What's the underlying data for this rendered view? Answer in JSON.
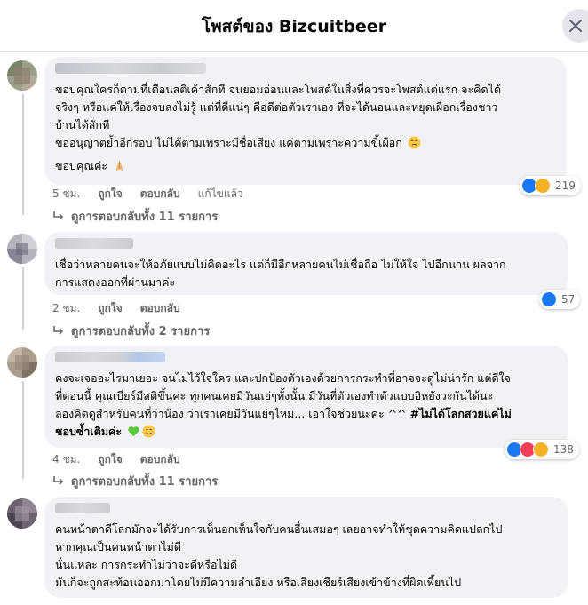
{
  "header": {
    "title": "โพสต์ของ Bizcuitbeer"
  },
  "comments": [
    {
      "lines": [
        "ขอบคุณใครก็ตามที่เตือนสติเค้าสักที จนยอมอ่อนและโพสต์ในสิ่งที่ควรจะโพสต์แต่แรก จะคิดได้",
        "จริงๆ หรือแค่ให้เรื่องจบลงไม่รู้ แต่ที่ดีแน่ๆ คือดีต่อตัวเราเอง ที่จะได้นอนและหยุดเผือกเรื่องชาว",
        "บ้านได้สักที",
        "ขออนุญาตย้ำอีกรอบ ไม่ได้ตามเพราะมีชื่อเสียง แค่ตามเพราะความขี้เผือก",
        "ขอบคุณค่ะ"
      ],
      "time": "5 ชม.",
      "like": "ถูกใจ",
      "reply": "ตอบกลับ",
      "edited": "แก้ไขแล้ว",
      "reaction_count": "219",
      "replies_label": "ดูการตอบกลับทั้ง 11 รายการ"
    },
    {
      "lines": [
        "เชื่อว่าหลายคนจะให้อภัยแบบไม่คิดอะไร แต่ก็มีอีกหลายคนไม่เชื่อถือ ไม่ให้ใจ ไปอีกนาน ผลจาก",
        "การแสดงออกที่ผ่านมาค่ะ"
      ],
      "time": "2 ชม.",
      "like": "ถูกใจ",
      "reply": "ตอบกลับ",
      "reaction_count": "57",
      "replies_label": "ดูการตอบกลับทั้ง 2 รายการ"
    },
    {
      "lines": [
        "คงจะเจออะไรมาเยอะ จนไม่ไว้ใจใคร และปกป้องตัวเองด้วยการกระทำที่อาจจะดูไม่น่ารัก แต่ดีใจ",
        "ที่ตอนนี้ คุณเบียร์มีสติขึ้นค่ะ ทุกคนเคยมีวันแย่ๆทั้งนั้น มีวันที่ตัวเองทำตัวแบบอิหยังวะกันได้นะ",
        "ลองคิดดูสำหรับคนที่ว่าน้อง ว่าเราเคยมีวันแย่ๆไหม... เอาใจช่วยนะคะ ^^ "
      ],
      "hashtag_1": "#ไม่ได้โลกสวยแค่ไม่",
      "hashtag_2": "ชอบซ้ำเติมค่ะ",
      "time": "4 ชม.",
      "like": "ถูกใจ",
      "reply": "ตอบกลับ",
      "reaction_count": "138",
      "replies_label": "ดูการตอบกลับทั้ง 11 รายการ"
    },
    {
      "lines": [
        "คนหน้าตาดีโลกมักจะได้รับการเห็นอกเห็นใจกับคนอื่นเสมอๆ เลยอาจทำให้ชุดความคิดแปลกไป",
        "หากคุณเป็นคนหน้าตาไม่ดี",
        "นั่นแหละ การกระทำไม่ว่าจะดีหรือไม่ดี",
        "มันก็จะถูกสะท้อนออกมาโดยไม่มีความลำเอียง หรือเสียงเชียร์เสียงเข้าข้างที่ผิดเพี้ยนไป"
      ]
    }
  ],
  "colors": {
    "like_blue": "#1877f2",
    "haha_yellow": "#f7b125",
    "love_red": "#f33e58",
    "bubble": "#f0f2f5",
    "secondary_text": "#65676b"
  }
}
